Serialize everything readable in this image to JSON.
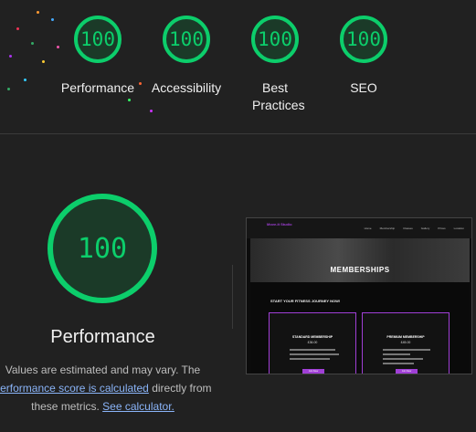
{
  "summary_gauges": [
    {
      "score": "100",
      "label": "Performance"
    },
    {
      "score": "100",
      "label": "Accessibility"
    },
    {
      "score": "100",
      "label": "Best Practices"
    },
    {
      "score": "100",
      "label": "SEO"
    }
  ],
  "performance": {
    "score": "100",
    "title": "Performance",
    "note_before": "Values are estimated and may vary. The ",
    "note_link": "performance score is calculated",
    "note_middle": " directly from these metrics. ",
    "calculator_link": "See calculator."
  },
  "thumbnail": {
    "logo": "Move-It Studio",
    "nav_links": [
      "Home",
      "Membership",
      "Classes",
      "Gallery",
      "Prices",
      "Location"
    ],
    "hero_title": "MEMBERSHIPS",
    "subtitle": "START YOUR FITNESS JOURNEY NOW!",
    "cards": [
      {
        "title": "STANDARD MEMBERSHIP",
        "price": "£36.00",
        "button": "Join Now"
      },
      {
        "title": "PREMIUM MEMBERSHIP",
        "price": "£45.00",
        "button": "Join Now"
      }
    ]
  },
  "colors": {
    "pass": "#0cce6b",
    "accent": "#a03fd6",
    "link": "#8ab4f8"
  }
}
